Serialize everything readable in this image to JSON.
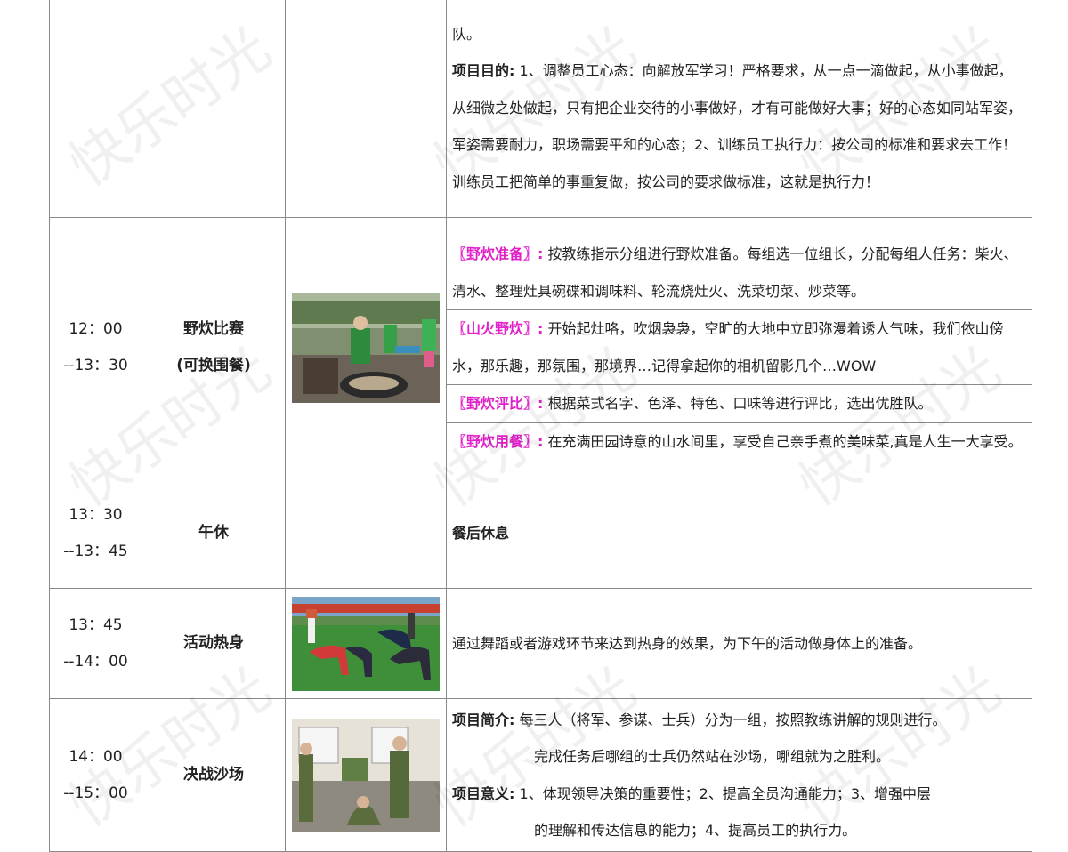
{
  "watermark_text": "快乐时光",
  "rows": [
    {
      "purpose_tail": "队。",
      "purpose_label": "项目目的:",
      "purpose_text": " 1、调整员工心态：向解放军学习！严格要求，从一点一滴做起，从小事做起，从细微之处做起，只有把企业交待的小事做好，才有可能做好大事；好的心态如同站军姿，军姿需要耐力，职场需要平和的心态；2、训练员工执行力：按公司的标准和要求去工作！训练员工把简单的事重复做，按公司的要求做标准，这就是执行力！"
    },
    {
      "time_start": "12：00",
      "time_end": "--13：30",
      "name_line1": "野炊比赛",
      "name_line2": "(可换围餐)",
      "items": [
        {
          "label": "〖野炊准备〗:",
          "text": " 按教练指示分组进行野炊准备。每组选一位组长，分配每组人任务：柴火、清水、整理灶具碗碟和调味料、轮流烧灶火、洗菜切菜、炒菜等。"
        },
        {
          "label": "〖山火野炊〗:",
          "text": " 开始起灶咯，吹烟袅袅，空旷的大地中立即弥漫着诱人气味，我们依山傍水，那乐趣，那氛围，那境界…记得拿起你的相机留影几个…WOW"
        },
        {
          "label": "〖野炊评比〗:",
          "text": " 根据菜式名字、色泽、特色、口味等进行评比，选出优胜队。"
        },
        {
          "label": "〖野炊用餐〗:",
          "text": " 在充满田园诗意的山水间里，享受自己亲手煮的美味菜,真是人生一大享受。"
        }
      ]
    },
    {
      "time_start": "13：30",
      "time_end": "--13：45",
      "name": "午休",
      "desc": "餐后休息"
    },
    {
      "time_start": "13：45",
      "time_end": "--14：00",
      "name": "活动热身",
      "desc": "通过舞蹈或者游戏环节来达到热身的效果，为下午的活动做身体上的准备。"
    },
    {
      "time_start": "14：00",
      "time_end": "--15：00",
      "name": "决战沙场",
      "intro_label": "项目简介:",
      "intro_text_1": " 每三人（将军、参谋、士兵）分为一组，按照教练讲解的规则进行。",
      "intro_text_2": "完成任务后哪组的士兵仍然站在沙场，哪组就为之胜利。",
      "meaning_label": "项目意义:",
      "meaning_text_1": " 1、体现领导决策的重要性；2、提高全员沟通能力；3、增强中层",
      "meaning_text_2": "的理解和传达信息的能力；4、提高员工的执行力。"
    }
  ],
  "colors": {
    "accent_label": "#e020c8",
    "border": "#8a8a8a"
  }
}
